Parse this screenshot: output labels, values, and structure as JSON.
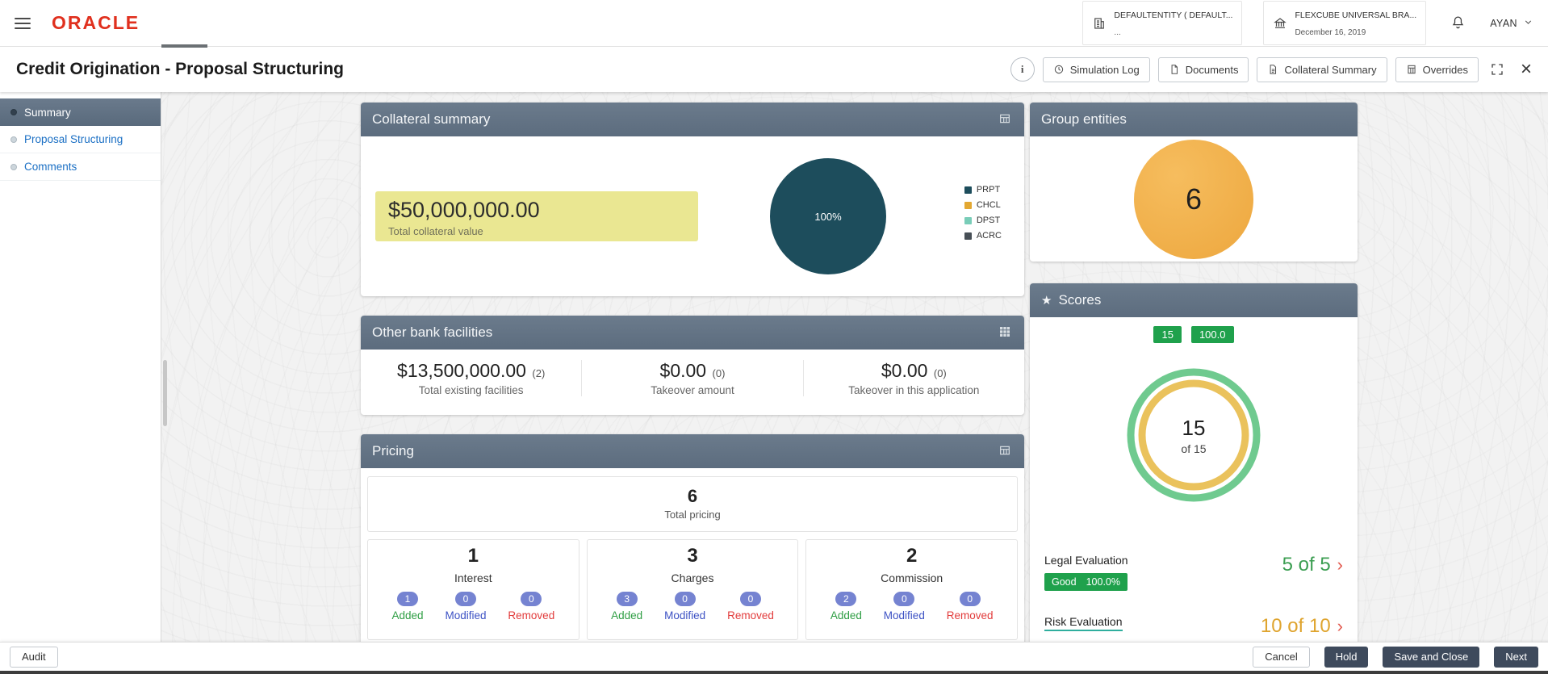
{
  "icons": {
    "star": "★",
    "close": "×",
    "arrow": "›",
    "info": "i"
  },
  "topbar": {
    "brand": "ORACLE",
    "entity_label": "DEFAULTENTITY ( DEFAULT...",
    "entity_sub": "...",
    "branch_label": "FLEXCUBE UNIVERSAL BRA...",
    "branch_date": "December 16, 2019",
    "user_name": "AYAN"
  },
  "header": {
    "title": "Credit Origination - Proposal Structuring",
    "buttons": {
      "simulation_log": "Simulation Log",
      "documents": "Documents",
      "collateral_summary": "Collateral Summary",
      "overrides": "Overrides"
    }
  },
  "sidebar": {
    "items": [
      {
        "label": "Summary",
        "active": true
      },
      {
        "label": "Proposal Structuring",
        "active": false
      },
      {
        "label": "Comments",
        "active": false
      }
    ]
  },
  "collateral": {
    "title": "Collateral summary",
    "total_value": "$50,000,000.00",
    "total_label": "Total collateral value",
    "pie_percent": "100%",
    "pie_color": "#1d4d5c",
    "legend": [
      {
        "label": "PRPT",
        "color": "#1d4d5c"
      },
      {
        "label": "CHCL",
        "color": "#e3a832"
      },
      {
        "label": "DPST",
        "color": "#79cdb8"
      },
      {
        "label": "ACRC",
        "color": "#474f56"
      }
    ]
  },
  "other_bank": {
    "title": "Other bank facilities",
    "stats": [
      {
        "value": "$13,500,000.00",
        "count": "(2)",
        "label": "Total existing facilities"
      },
      {
        "value": "$0.00",
        "count": "(0)",
        "label": "Takeover amount"
      },
      {
        "value": "$0.00",
        "count": "(0)",
        "label": "Takeover in this application"
      }
    ]
  },
  "pricing": {
    "title": "Pricing",
    "total": "6",
    "total_label": "Total pricing",
    "groups": [
      {
        "count": "1",
        "label": "Interest",
        "chips": [
          {
            "value": "1",
            "label": "Added"
          },
          {
            "value": "0",
            "label": "Modified"
          },
          {
            "value": "0",
            "label": "Removed"
          }
        ]
      },
      {
        "count": "3",
        "label": "Charges",
        "chips": [
          {
            "value": "3",
            "label": "Added"
          },
          {
            "value": "0",
            "label": "Modified"
          },
          {
            "value": "0",
            "label": "Removed"
          }
        ]
      },
      {
        "count": "2",
        "label": "Commission",
        "chips": [
          {
            "value": "2",
            "label": "Added"
          },
          {
            "value": "0",
            "label": "Modified"
          },
          {
            "value": "0",
            "label": "Removed"
          }
        ]
      }
    ]
  },
  "group_entities": {
    "title": "Group entities",
    "count": "6",
    "circle_color": "#f0ad49"
  },
  "scores": {
    "title": "Scores",
    "badge_score": "15",
    "badge_percent": "100.0",
    "donut_value": "15",
    "donut_sub": "of 15",
    "rows": [
      {
        "label": "Legal Evaluation",
        "status": "Good",
        "percent": "100.0%",
        "score": "5 of 5"
      },
      {
        "label": "Risk Evaluation",
        "score": "10 of 10"
      }
    ]
  },
  "footer": {
    "audit": "Audit",
    "cancel": "Cancel",
    "hold": "Hold",
    "save_and_close": "Save and Close",
    "next": "Next"
  },
  "colors": {
    "card_header_slate": "#5f6f81",
    "badge_green": "#1fa14c",
    "score_green": "#3c9e52",
    "score_amber": "#dfa42e",
    "chip_blue": "#7583d1",
    "added_green": "#2f9e44",
    "modified_blue": "#3d52c4",
    "removed_red": "#e23b3b",
    "highlight_yellow": "#eae792",
    "oracle_red": "#e0301e",
    "donut_outer_green": "#6fca8f",
    "donut_inner_yellow": "#eac25c",
    "group_circle_orange": "#f0ad49"
  }
}
